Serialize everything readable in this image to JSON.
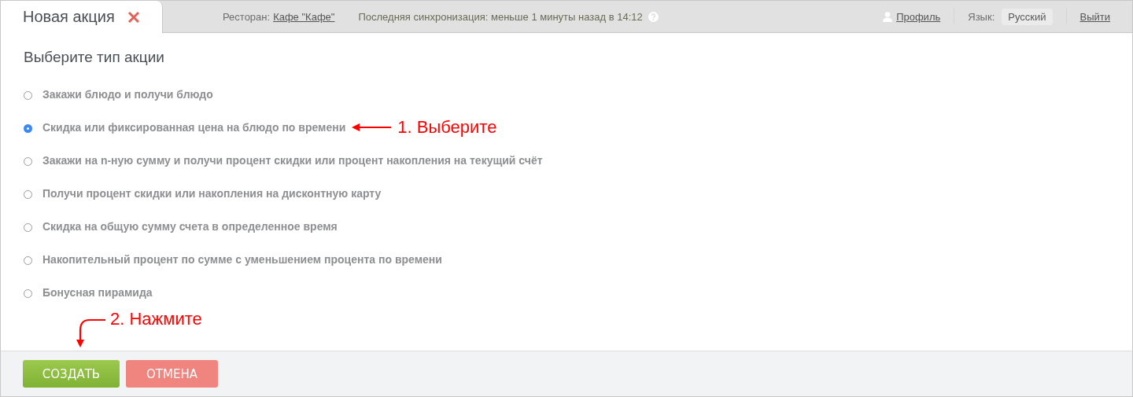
{
  "tab": {
    "title": "Новая акция"
  },
  "topbar": {
    "restaurant_label": "Ресторан:",
    "restaurant": "Кафе \"Кафе\"",
    "sync": "Последняя синхронизация: меньше 1 минуты назад в 14:12",
    "profile": "Профиль",
    "language_label": "Язык:",
    "language": "Русский",
    "logout": "Выйти"
  },
  "heading": "Выберите тип акции",
  "options": [
    {
      "label": "Закажи блюдо и получи блюдо",
      "selected": false
    },
    {
      "label": "Скидка или фиксированная цена на блюдо по времени",
      "selected": true,
      "annotation": "1. Выберите"
    },
    {
      "label": "Закажи на n-ную сумму и получи процент скидки или процент накопления на текущий счёт",
      "selected": false
    },
    {
      "label": "Получи процент скидки или накопления на дисконтную карту",
      "selected": false
    },
    {
      "label": "Скидка на общую сумму счета в определенное время",
      "selected": false
    },
    {
      "label": "Накопительный процент по сумме с уменьшением процента по времени",
      "selected": false
    },
    {
      "label": "Бонусная пирамида",
      "selected": false
    }
  ],
  "footer": {
    "annotation": "2. Нажмите",
    "buttons": [
      {
        "label": "СОЗДАТЬ",
        "kind": "primary"
      },
      {
        "label": "ОТМЕНА",
        "kind": "danger"
      }
    ]
  }
}
